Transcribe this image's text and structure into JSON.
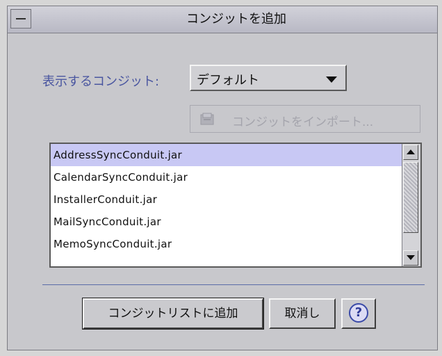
{
  "window": {
    "title": "コンジットを追加"
  },
  "filter": {
    "label": "表示するコンジット:",
    "selected": "デフォルト"
  },
  "import_button": {
    "label": "コンジットをインポート..."
  },
  "conduits": [
    {
      "name": "AddressSyncConduit.jar",
      "selected": true
    },
    {
      "name": "CalendarSyncConduit.jar",
      "selected": false
    },
    {
      "name": "InstallerConduit.jar",
      "selected": false
    },
    {
      "name": "MailSyncConduit.jar",
      "selected": false
    },
    {
      "name": "MemoSyncConduit.jar",
      "selected": false
    }
  ],
  "buttons": {
    "add": "コンジットリストに追加",
    "cancel": "取消し",
    "help": "?"
  },
  "colors": {
    "label_blue": "#4a56a0",
    "selection": "#c8c8f4",
    "background": "#c8c8cc"
  },
  "icons": {
    "help": "help-icon",
    "import": "import-icon"
  }
}
